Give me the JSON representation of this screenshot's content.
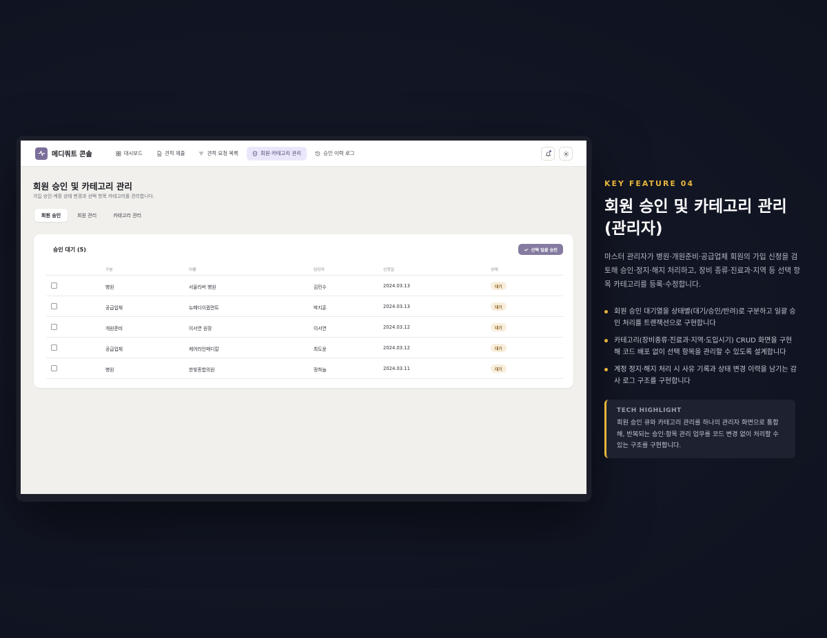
{
  "app": {
    "logo_text": "메디쿼트 콘솔",
    "nav": [
      {
        "label": "대시보드",
        "icon": "dashboard-icon"
      },
      {
        "label": "견적 제출",
        "icon": "document-icon"
      },
      {
        "label": "견적 요청 목록",
        "icon": "filter-icon"
      },
      {
        "label": "회원·카테고리 관리",
        "icon": "shield-icon",
        "active": true
      },
      {
        "label": "승인 이력 로그",
        "icon": "history-icon"
      }
    ],
    "actions": [
      "bell-icon",
      "gear-icon"
    ]
  },
  "page": {
    "title": "회원 승인 및 카테고리 관리",
    "subtitle": "가입 승인·계정 상태 변경과 선택 항목 카테고리를 관리합니다.",
    "tabs": [
      "회원 승인",
      "회원 관리",
      "카테고리 관리"
    ]
  },
  "card": {
    "title": "승인 대기 (5)",
    "bulk_button": "선택 일괄 승인",
    "columns": [
      "구분",
      "이름",
      "담당자",
      "신청일",
      "상태"
    ],
    "rows": [
      {
        "type": "병원",
        "name": "서울리버 병원",
        "manager": "김민수",
        "date": "2024.03.13",
        "status": "대기"
      },
      {
        "type": "공급업체",
        "name": "뉴메디이큅먼트",
        "manager": "박지훈",
        "date": "2024.03.13",
        "status": "대기"
      },
      {
        "type": "개원준비",
        "name": "이서연 원장",
        "manager": "이서연",
        "date": "2024.03.12",
        "status": "대기"
      },
      {
        "type": "공급업체",
        "name": "케어라인메디칼",
        "manager": "최도윤",
        "date": "2024.03.12",
        "status": "대기"
      },
      {
        "type": "병원",
        "name": "한빛종합의원",
        "manager": "정하늘",
        "date": "2024.03.11",
        "status": "대기"
      }
    ]
  },
  "feature": {
    "kicker": "KEY FEATURE 04",
    "headline": "회원 승인 및 카테고리 관리 (관리자)",
    "description": "마스터 관리자가 병원·개원준비·공급업체 회원의 가입 신청을 검토해 승인·정지·해지 처리하고, 장비 종류·진료과·지역 등 선택 항목 카테고리를 등록·수정합니다.",
    "bullets": [
      "회원 승인 대기열을 상태별(대기/승인/반려)로 구분하고 일괄 승인 처리를 트랜잭션으로 구현합니다",
      "카테고리(장비종류·진료과·지역·도입시기) CRUD 화면을 구현해 코드 배포 없이 선택 항목을 관리할 수 있도록 설계합니다",
      "계정 정지·해지 처리 시 사유 기록과 상태 변경 이력을 남기는 감사 로그 구조를 구현합니다"
    ],
    "tech_label": "TECH HIGHLIGHT",
    "tech_text": "회원 승인 큐와 카테고리 관리를 하나의 관리자 화면으로 통합해, 반복되는 승인·항목 관리 업무를 코드 변경 없이 처리할 수 있는 구조를 구현합니다."
  },
  "colors": {
    "accent": "#e8b53b",
    "brand": "#7a6e99",
    "background": "#111522"
  }
}
